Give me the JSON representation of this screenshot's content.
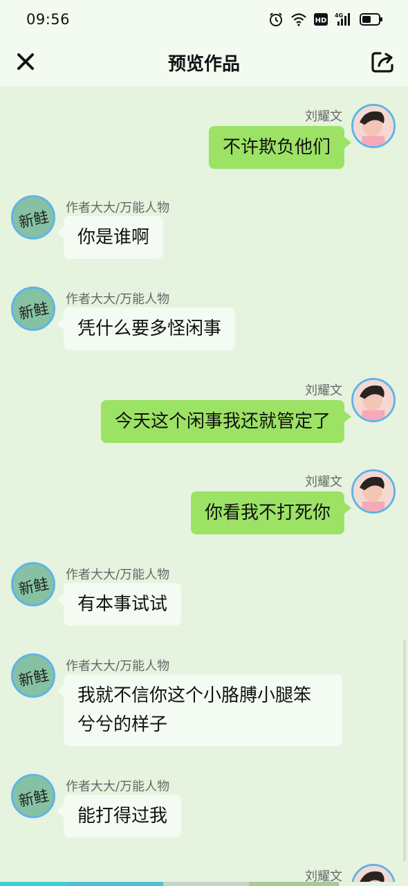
{
  "status_bar": {
    "time": "09:56",
    "network": "4G",
    "hd": "HD",
    "icons": [
      "alarm-icon",
      "wifi-icon",
      "hd-icon",
      "signal-icon",
      "battery-icon"
    ]
  },
  "header": {
    "title": "预览作品",
    "close_icon": "close-icon",
    "share_icon": "share-icon"
  },
  "messages": [
    {
      "side": "right",
      "name": "刘耀文",
      "text": "不许欺负他们"
    },
    {
      "side": "left",
      "name": "作者大大/万能人物",
      "text": "你是谁啊"
    },
    {
      "side": "left",
      "name": "作者大大/万能人物",
      "text": "凭什么要多怪闲事"
    },
    {
      "side": "right",
      "name": "刘耀文",
      "text": "今天这个闲事我还就管定了"
    },
    {
      "side": "right",
      "name": "刘耀文",
      "text": "你看我不打死你"
    },
    {
      "side": "left",
      "name": "作者大大/万能人物",
      "text": "有本事试试"
    },
    {
      "side": "left",
      "name": "作者大大/万能人物",
      "text_lines": [
        "我就不信你这个小胳膊小腿笨",
        "兮兮的样子"
      ]
    },
    {
      "side": "left",
      "name": "作者大大/万能人物",
      "text": "能打得过我"
    },
    {
      "side": "right",
      "name": "刘耀文",
      "text": ""
    }
  ],
  "author_avatar_text": "新鲑",
  "colors": {
    "background": "#e6f3df",
    "header": "#f3fbf1",
    "bubble_right": "#9ce265",
    "bubble_left": "#f4fbf2",
    "avatar_border": "#5fb3e8"
  }
}
